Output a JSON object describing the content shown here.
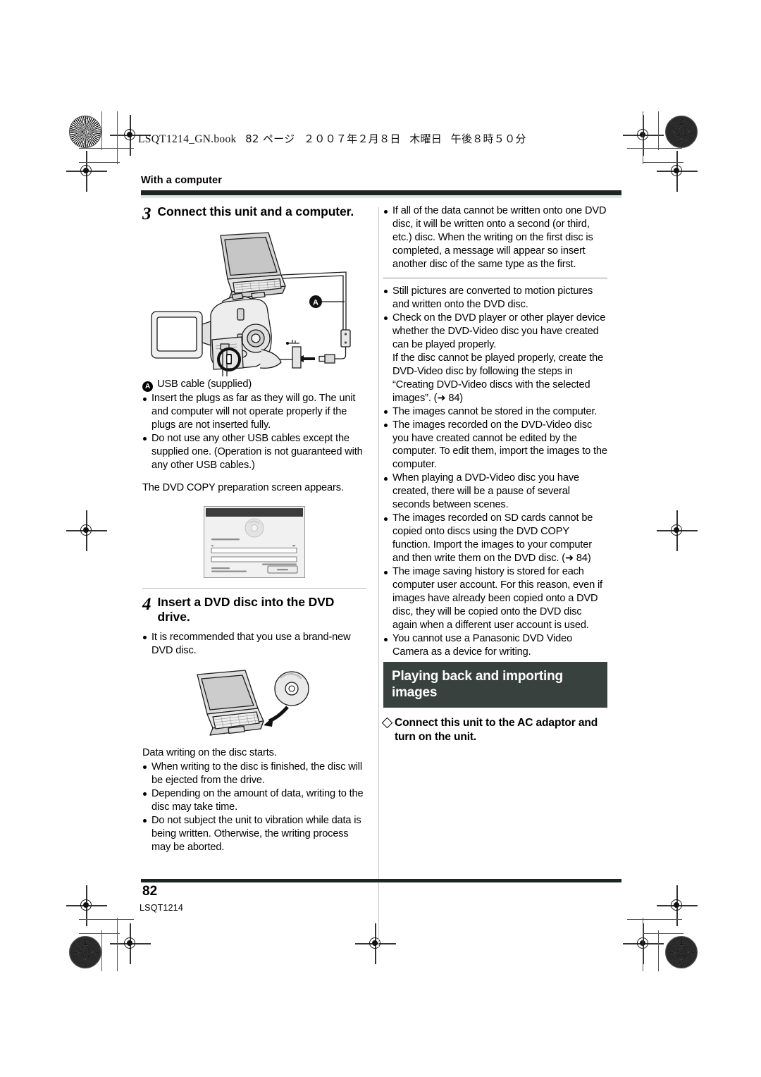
{
  "print_header": {
    "book_line": "LSQT1214_GN.book",
    "page_marker": "82 ページ",
    "date_jp": "２００７年２月８日",
    "weekday_jp": "木曜日",
    "time_jp": "午後８時５０分"
  },
  "running_head": "With a computer",
  "left_column": {
    "step3": {
      "number": "3",
      "title": "Connect this unit and a computer."
    },
    "callout_a": {
      "marker": "A",
      "label": "USB cable (supplied)"
    },
    "bullets_after_fig": [
      "Insert the plugs as far as they will go. The unit and computer will not operate properly if the plugs are not inserted fully.",
      "Do not use any other USB cables except the supplied one. (Operation is not guaranteed with any other USB cables.)"
    ],
    "result_text": "The DVD COPY preparation screen appears.",
    "dialog_screenshot": {
      "title_bar": "",
      "status_line": "Preparing the Top DVD file...",
      "range_start": "0",
      "range_end": "100",
      "time_note": "Time Needed On This Disc: 4 min 30 s",
      "status_left_line1": "Calculating",
      "status_left_line2": "Remaining time to complete (estimated)",
      "cancel_button": "Cancel"
    },
    "step4": {
      "number": "4",
      "title": "Insert a DVD disc into the DVD drive."
    },
    "step4_bullets": [
      "It is recommended that you use a brand-new DVD disc."
    ],
    "result_text2": "Data writing on the disc starts.",
    "bullets_end": [
      "When writing to the disc is finished, the disc will be ejected from the drive.",
      "Depending on the amount of data, writing to the disc may take time.",
      "Do not subject the unit to vibration while data is being written. Otherwise, the writing process may be aborted."
    ]
  },
  "right_column": {
    "group1": [
      "If all of the data cannot be written onto one DVD disc, it will be written onto a second (or third, etc.) disc. When the writing on the first disc is completed, a message will appear so insert another disc of the same type as the first."
    ],
    "group2": [
      "Still pictures are converted to motion pictures and written onto the DVD disc.",
      "Check on the DVD player or other player device whether the DVD-Video disc you have created can be played properly.\nIf the disc cannot be played properly, create the DVD-Video disc by following the steps in “Creating DVD-Video discs with the selected images”. (➜ 84)",
      "The images cannot be stored in the computer.",
      "The images recorded on the DVD-Video disc you have created cannot be edited by the computer. To edit them, import the images to the computer.",
      "When playing a DVD-Video disc you have created, there will be a pause of several seconds between scenes.",
      "The images recorded on SD cards cannot be copied onto discs using the DVD COPY function. Import the images to your computer and then write them on the DVD disc. (➜ 84)",
      "The image saving history is stored for each computer user account. For this reason, even if images have already been copied onto a DVD disc, they will be copied onto the DVD disc again when a different user account is used.",
      "You cannot use a Panasonic DVD Video Camera as a device for writing."
    ],
    "section_heading": "Playing back and importing images",
    "sub_heading": "Connect this unit to the AC adaptor and turn on the unit."
  },
  "footer": {
    "page_number": "82",
    "part_number": "LSQT1214"
  },
  "colors": {
    "rule_bar": "#1d2522",
    "rule_shadow": "#dfe7e0",
    "section_bar": "#39413f",
    "text": "#000000"
  }
}
